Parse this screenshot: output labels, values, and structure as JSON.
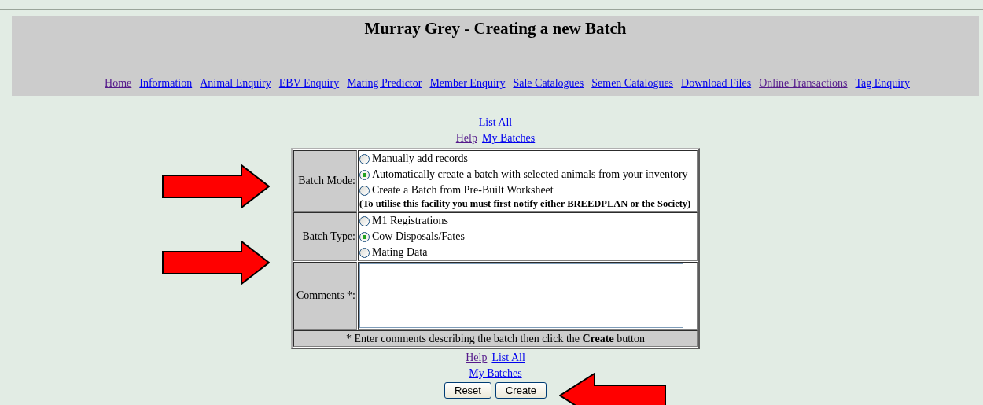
{
  "header": {
    "title": "Murray Grey - Creating a new Batch"
  },
  "nav": [
    {
      "label": "Home",
      "visited": true
    },
    {
      "label": "Information",
      "visited": false
    },
    {
      "label": "Animal Enquiry",
      "visited": false
    },
    {
      "label": "EBV Enquiry",
      "visited": false
    },
    {
      "label": "Mating Predictor",
      "visited": false
    },
    {
      "label": "Member Enquiry",
      "visited": false
    },
    {
      "label": "Sale Catalogues",
      "visited": false
    },
    {
      "label": "Semen Catalogues",
      "visited": false
    },
    {
      "label": "Download Files",
      "visited": false
    },
    {
      "label": "Online Transactions",
      "visited": true
    },
    {
      "label": "Tag Enquiry",
      "visited": false
    }
  ],
  "top_links": [
    [
      {
        "label": "List All",
        "visited": false
      }
    ],
    [
      {
        "label": "Help",
        "visited": true
      },
      {
        "label": "My Batches",
        "visited": false
      }
    ]
  ],
  "form": {
    "rows": [
      {
        "label": "Batch Mode:",
        "kind": "radio",
        "options": [
          {
            "label": "Manually add records",
            "selected": false
          },
          {
            "label": "Automatically create a batch with selected animals from your inventory",
            "selected": true
          },
          {
            "label": "Create a Batch from Pre-Built Worksheet",
            "selected": false
          }
        ],
        "note": "(To utilise this facility you must first notify either BREEDPLAN or the Society)"
      },
      {
        "label": "Batch Type:",
        "kind": "radio",
        "options": [
          {
            "label": "M1 Registrations",
            "selected": false
          },
          {
            "label": "Cow Disposals/Fates",
            "selected": true
          },
          {
            "label": "Mating Data",
            "selected": false
          }
        ]
      },
      {
        "label": "Comments *:",
        "kind": "textarea"
      }
    ],
    "footer": "* Enter comments describing the batch then click the **Create** button"
  },
  "bottom_links": [
    [
      {
        "label": "Help",
        "visited": true
      },
      {
        "label": "List All",
        "visited": false
      }
    ],
    [
      {
        "label": "My Batches",
        "visited": false
      }
    ]
  ],
  "buttons": [
    "Reset",
    "Create"
  ],
  "arrows": [
    {
      "kind": "right"
    },
    {
      "kind": "right"
    },
    {
      "kind": "left"
    }
  ]
}
